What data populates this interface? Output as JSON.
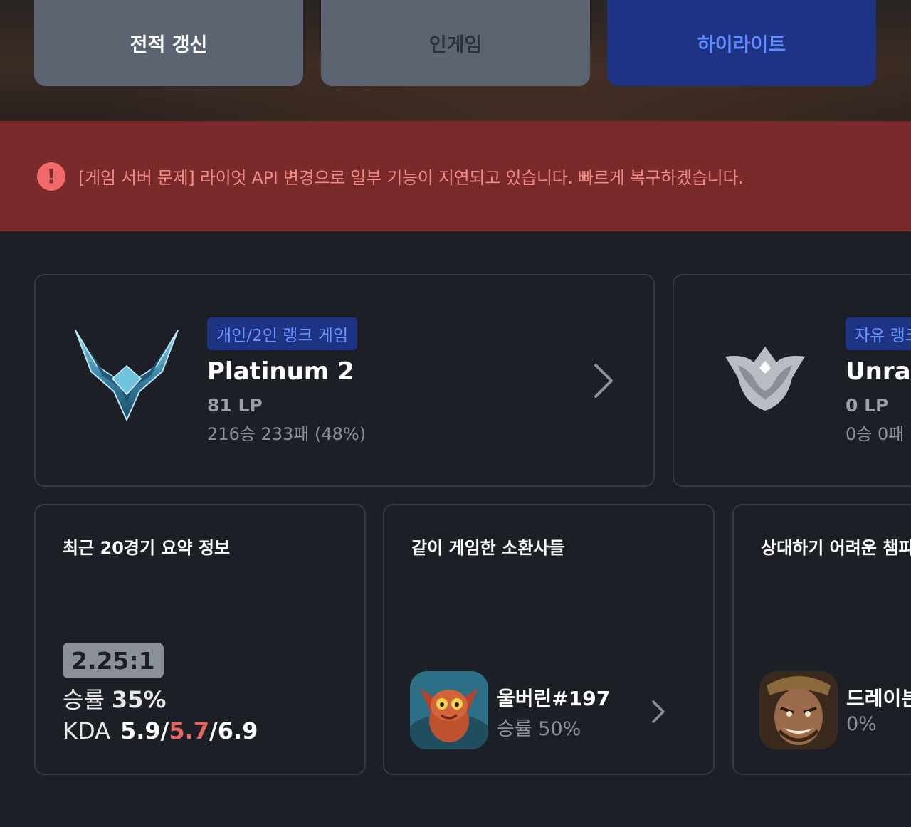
{
  "actions": {
    "refresh_label": "전적 갱신",
    "ingame_label": "인게임",
    "highlight_label": "하이라이트"
  },
  "notice": {
    "icon": "exclamation-icon",
    "icon_glyph": "!",
    "text": "[게임 서버 문제] 라이엇 API 변경으로 일부 기능이 지연되고 있습니다. 빠르게 복구하겠습니다."
  },
  "ranks": {
    "solo": {
      "queue": "개인/2인 랭크 게임",
      "tier": "Platinum 2",
      "lp": "81 LP",
      "record": "216승 233패 (48%)",
      "emblem_icon": "platinum-emblem-icon"
    },
    "flex": {
      "queue": "자유 랭크",
      "tier": "Unranked",
      "lp": "0 LP",
      "record": "0승 0패",
      "emblem_icon": "unranked-emblem-icon"
    }
  },
  "summary": {
    "title": "최근 20경기 요약 정보",
    "kda_ratio": "2.25:1",
    "winrate_label": "승률",
    "winrate_value": "35%",
    "kda_label": "KDA",
    "kills": "5.9",
    "deaths": "5.7",
    "assists": "6.9",
    "separator": "/"
  },
  "duo": {
    "title": "같이 게임한 소환사들",
    "name": "울버린#197",
    "winrate": "승률 50%"
  },
  "hard_champ": {
    "title": "상대하기 어려운 챔피언",
    "name": "드레이븐",
    "winrate": "0%"
  },
  "colors": {
    "accent_blue": "#1e3383",
    "accent_blue_text": "#6a94ff",
    "notice_bg": "#7a2a2a",
    "notice_text": "#f08a86",
    "deaths_red": "#e5665c"
  }
}
